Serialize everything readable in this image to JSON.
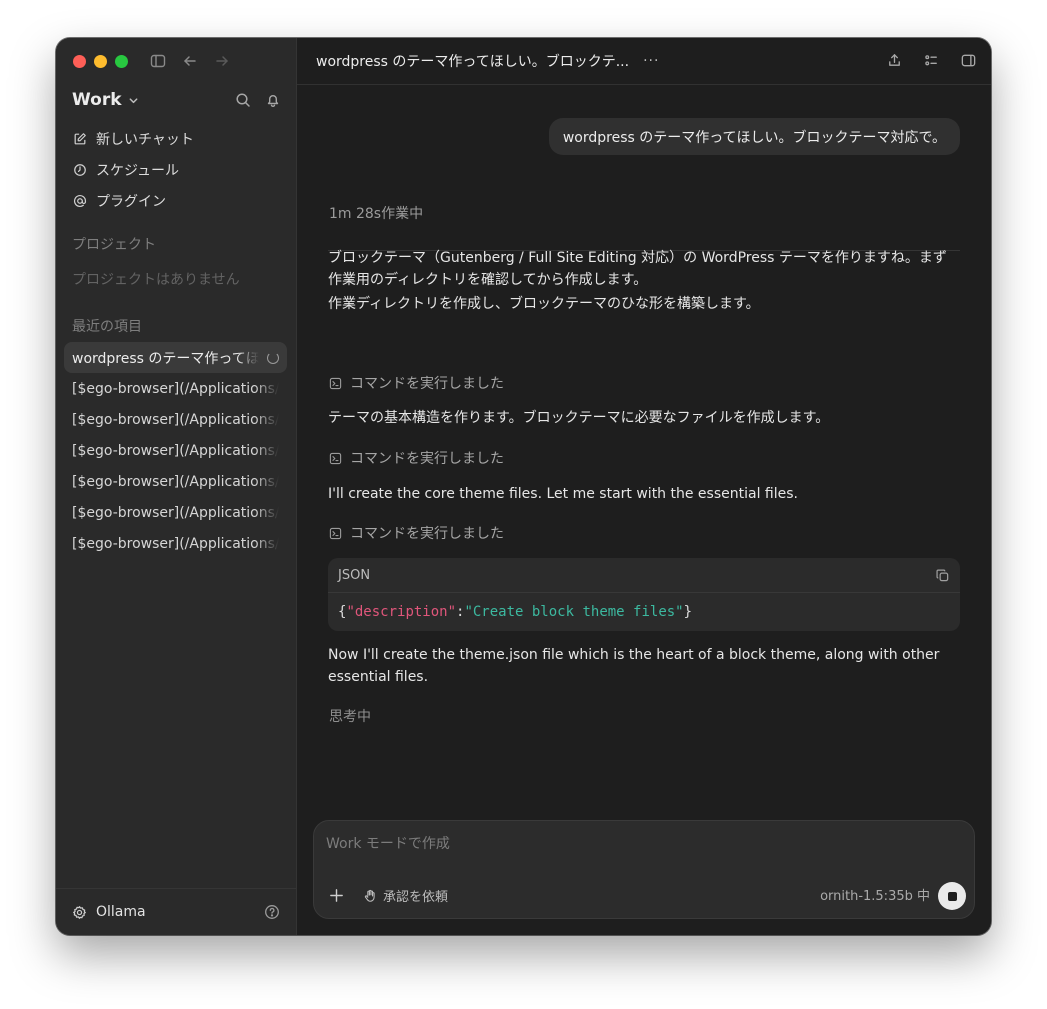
{
  "sidebar": {
    "workspace": "Work",
    "nav": [
      {
        "label": "新しいチャット",
        "icon": "compose-icon"
      },
      {
        "label": "スケジュール",
        "icon": "clock-icon"
      },
      {
        "label": "プラグイン",
        "icon": "at-icon"
      }
    ],
    "projects_label": "プロジェクト",
    "projects_empty": "プロジェクトはありません",
    "recent_label": "最近の項目",
    "recent": [
      "wordpress のテーマ作ってほしい。ブロックテーマ対応で。",
      "[$ego-browser](/Applications/ego-browser)",
      "[$ego-browser](/Applications/ego-browser)",
      "[$ego-browser](/Applications/ego-browser)",
      "[$ego-browser](/Applications/ego-browser)",
      "[$ego-browser](/Applications/ego-browser)",
      "[$ego-browser](/Applications/ego-browser)"
    ],
    "account": "Ollama"
  },
  "header": {
    "title": "wordpress のテーマ作ってほしい。ブロックテ...",
    "more": "···"
  },
  "chat": {
    "user_message": "wordpress のテーマ作ってほしい。ブロックテーマ対応で。",
    "status": "1m 28s作業中",
    "para1": "ブロックテーマ（Gutenberg / Full Site Editing 対応）の WordPress テーマを作りますね。まず作業用のディレクトリを確認してから作成します。",
    "para2": "作業ディレクトリを作成し、ブロックテーマのひな形を構築します。",
    "command_label": "コマンドを実行しました",
    "para3": "テーマの基本構造を作ります。ブロックテーマに必要なファイルを作成します。",
    "para4": "I'll create the core theme files. Let me start with the essential files.",
    "code": {
      "lang": "JSON",
      "open": "{",
      "key": "\"description\"",
      "colon": ":",
      "value": "\"Create block theme files\"",
      "close": "}"
    },
    "para5": "Now I'll create the theme.json file which is the heart of a block theme, along with other essential files.",
    "thinking": "思考中"
  },
  "composer": {
    "placeholder": "Work モードで作成",
    "approval": "承認を依頼",
    "model": "ornith-1.5:35b 中"
  },
  "colors": {
    "window_bg": "#1e1e1e",
    "sidebar_bg": "#2a2a2a",
    "json_key": "#e0567b",
    "json_string": "#3cb9a0"
  }
}
